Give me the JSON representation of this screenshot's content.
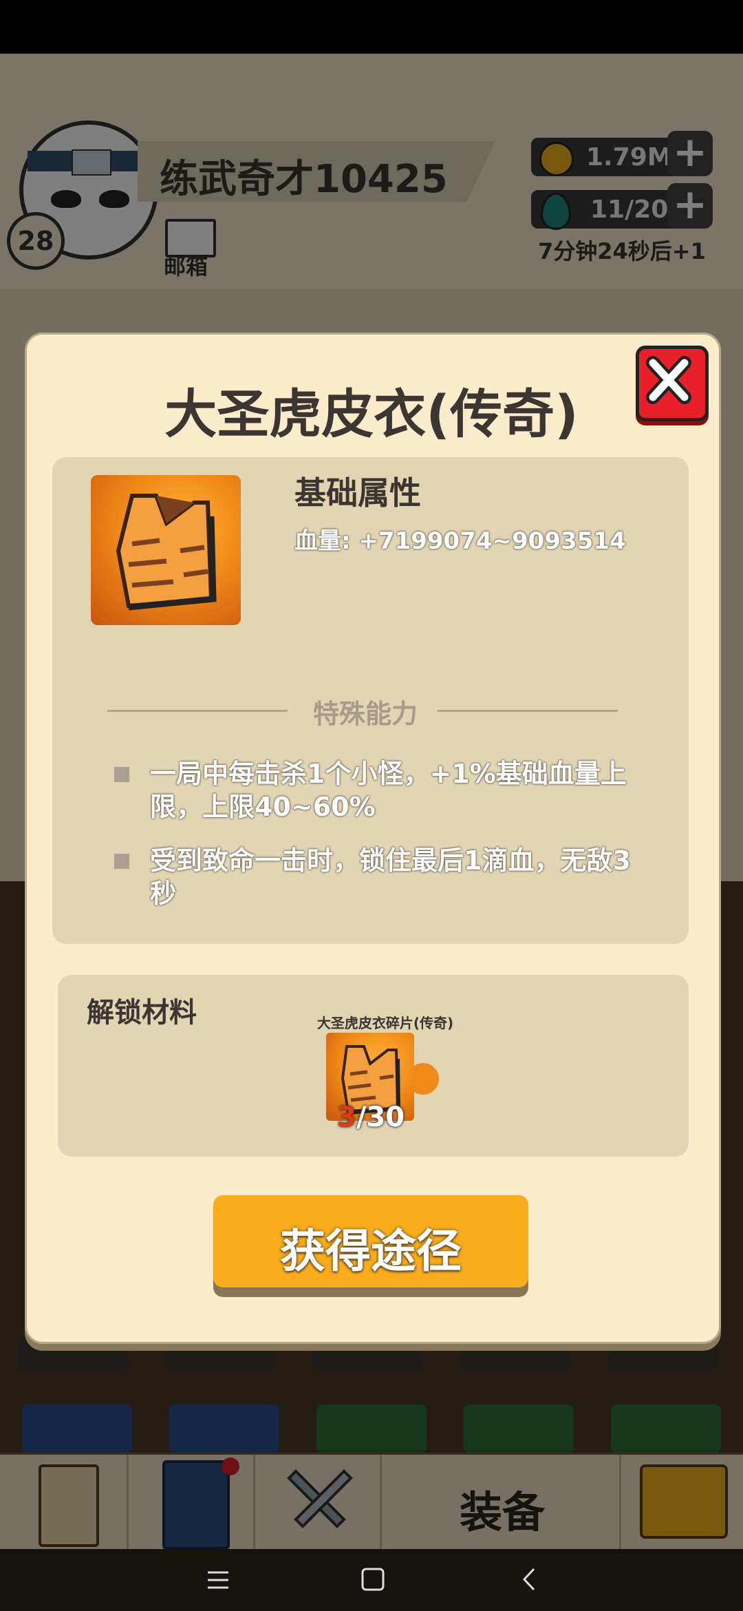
{
  "player": {
    "name": "练武奇才10425",
    "level": "28",
    "mail_label": "邮箱"
  },
  "resources": {
    "coins": "1.79M",
    "energy": "11/20",
    "energy_timer": "7分钟24秒后+1",
    "plus": "+"
  },
  "bottom_nav": {
    "equip_label": "装备"
  },
  "modal": {
    "title": "大圣虎皮衣(传奇)",
    "base_title": "基础属性",
    "hp_stat": "血量: +7199074~9093514",
    "special_title": "特殊能力",
    "abilities": [
      "一局中每击杀1个小怪，+1%基础血量上限，上限40~60%",
      "受到致命一击时，锁住最后1滴血，无敌3秒"
    ],
    "unlock_title": "解锁材料",
    "fragment": {
      "name": "大圣虎皮衣碎片(传奇)",
      "have": "3",
      "need": "/30"
    },
    "get_button": "获得途径"
  },
  "colors": {
    "modal_bg": "#fbeccc",
    "panel_bg": "#e1d5b4",
    "button_orange": "#f9ad1c",
    "close_red": "#e8202a",
    "count_red": "#e03a10"
  }
}
